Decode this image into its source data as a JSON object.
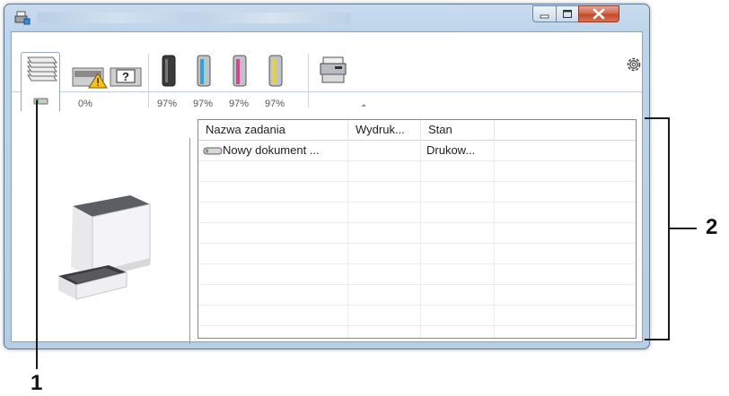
{
  "window": {
    "icon": "printer-status-icon",
    "controls": [
      "minimize-icon",
      "maximize-icon",
      "close-icon"
    ]
  },
  "toolbar": {
    "items": [
      {
        "icon": "job-stack-icon"
      },
      {
        "icon": "paper-warning-icon",
        "value": "0%"
      },
      {
        "icon": "toner-black-icon",
        "color": "#3a3a3a",
        "value": "97%"
      },
      {
        "icon": "toner-cyan-icon",
        "color": "#2fa4d8",
        "value": "97%"
      },
      {
        "icon": "toner-magenta-icon",
        "color": "#d6419a",
        "value": "97%"
      },
      {
        "icon": "toner-yellow-icon",
        "color": "#e4d43a",
        "value": "97%"
      },
      {
        "icon": "device-icon"
      }
    ],
    "settings_icon": "gear-icon",
    "collapse_icon": "chevron-up-icon",
    "collapse_glyph": "⌃"
  },
  "jobs": {
    "columns": [
      "Nazwa zadania",
      "Wydruk...",
      "Stan"
    ],
    "rows": [
      {
        "name": "Nowy dokument ...",
        "printed": "",
        "status": "Drukow..."
      }
    ]
  },
  "annotations": {
    "callout_1": "1",
    "callout_2": "2"
  }
}
